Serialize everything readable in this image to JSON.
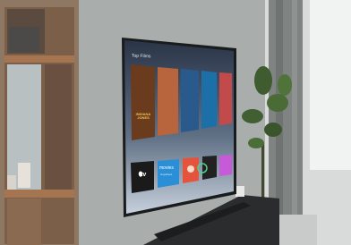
{
  "tv": {
    "section_title": "Top Films",
    "posters": [
      {
        "name": "indiana-jones-poster",
        "title": "INDIANA JONES",
        "color": "#6b3b1e"
      },
      {
        "name": "film-poster-2",
        "title": "",
        "color": "#b8643c"
      },
      {
        "name": "film-poster-3",
        "title": "",
        "color": "#2a5a8c"
      },
      {
        "name": "film-poster-4",
        "title": "",
        "color": "#1d6fa8"
      },
      {
        "name": "film-poster-5",
        "title": "",
        "color": "#c24a4a"
      }
    ],
    "apps": [
      {
        "name": "apple-tv-app",
        "label": "tv",
        "icon": "apple-logo-icon",
        "color": "#1a1a1a"
      },
      {
        "name": "movies-app",
        "label": "movies",
        "sub": "Anywhere",
        "color": "#2a8fd6"
      },
      {
        "name": "app-3",
        "label": "",
        "color": "#e5533c"
      },
      {
        "name": "app-4",
        "label": "",
        "color": "#222222"
      },
      {
        "name": "app-5",
        "label": "",
        "color": "#c75ad8"
      }
    ]
  }
}
